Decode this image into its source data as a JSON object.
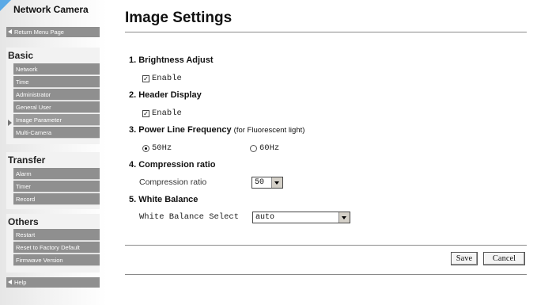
{
  "sidebar": {
    "title": "Network Camera",
    "return_label": "Return Menu Page",
    "sections": [
      {
        "title": "Basic",
        "items": [
          "Network",
          "Time",
          "Administrator",
          "General User",
          "Image Parameter",
          "Multi-Camera"
        ]
      },
      {
        "title": "Transfer",
        "items": [
          "Alarm",
          "Timer",
          "Record"
        ]
      },
      {
        "title": "Others",
        "items": [
          "Restart",
          "Reset to Factory Default",
          "Firmwave Version"
        ]
      }
    ],
    "help_label": "Help"
  },
  "main": {
    "title": "Image Settings",
    "brightness": {
      "heading": "1. Brightness Adjust",
      "enable_label": "Enable",
      "checked": true
    },
    "header_display": {
      "heading": "2. Header Display",
      "enable_label": "Enable",
      "checked": true
    },
    "power_line": {
      "heading": "3. Power Line Frequency",
      "note": "(for Fluorescent light)",
      "option_50": "50Hz",
      "option_60": "60Hz",
      "selected": "50Hz"
    },
    "compression": {
      "heading": "4. Compression ratio",
      "label": "Compression ratio",
      "value": "50"
    },
    "white_balance": {
      "heading": "5. White Balance",
      "label": "White Balance Select",
      "value": "auto"
    },
    "save_label": "Save",
    "cancel_label": "Cancel"
  }
}
